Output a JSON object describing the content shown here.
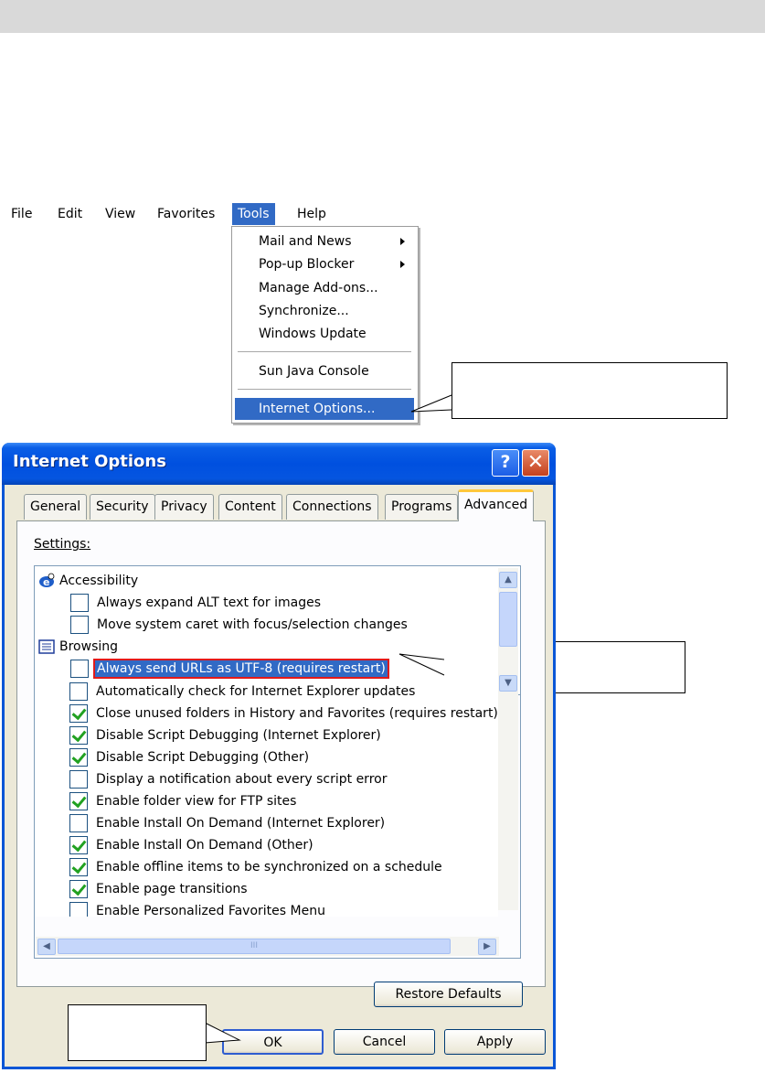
{
  "menu": {
    "bar": [
      "File",
      "Edit",
      "View",
      "Favorites",
      "Tools",
      "Help"
    ],
    "tools_items": [
      "Mail and News",
      "Pop-up Blocker",
      "Manage Add-ons...",
      "Synchronize...",
      "Windows Update",
      "Sun Java Console",
      "Internet Options..."
    ]
  },
  "dialog": {
    "title": "Internet Options",
    "help_glyph": "?",
    "close_glyph": "✕",
    "tabs": [
      "General",
      "Security",
      "Privacy",
      "Content",
      "Connections",
      "Programs",
      "Advanced"
    ],
    "active_tab": "Advanced",
    "settings_label": "Settings:",
    "categories": {
      "accessibility": "Accessibility",
      "browsing": "Browsing"
    },
    "items": [
      {
        "label": "Always expand ALT text for images",
        "checked": false
      },
      {
        "label": "Move system caret with focus/selection changes",
        "checked": false
      },
      {
        "label": "Always send URLs as UTF-8 (requires restart)",
        "checked": false
      },
      {
        "label": "Automatically check for Internet Explorer updates",
        "checked": false
      },
      {
        "label": "Close unused folders in History and Favorites (requires restart)",
        "checked": true
      },
      {
        "label": "Disable Script Debugging (Internet Explorer)",
        "checked": true
      },
      {
        "label": "Disable Script Debugging (Other)",
        "checked": true
      },
      {
        "label": "Display a notification about every script error",
        "checked": false
      },
      {
        "label": "Enable folder view for FTP sites",
        "checked": true
      },
      {
        "label": "Enable Install On Demand (Internet Explorer)",
        "checked": false
      },
      {
        "label": "Enable Install On Demand (Other)",
        "checked": true
      },
      {
        "label": "Enable offline items to be synchronized on a schedule",
        "checked": true
      },
      {
        "label": "Enable page transitions",
        "checked": true
      },
      {
        "label": "Enable Personalized Favorites Menu",
        "checked": false
      }
    ],
    "scroll_glyphs": {
      "up": "▲",
      "down": "▼",
      "left": "◀",
      "right": "▶",
      "grip": "III"
    },
    "buttons": {
      "restore": "Restore Defaults",
      "ok": "OK",
      "cancel": "Cancel",
      "apply": "Apply"
    }
  }
}
